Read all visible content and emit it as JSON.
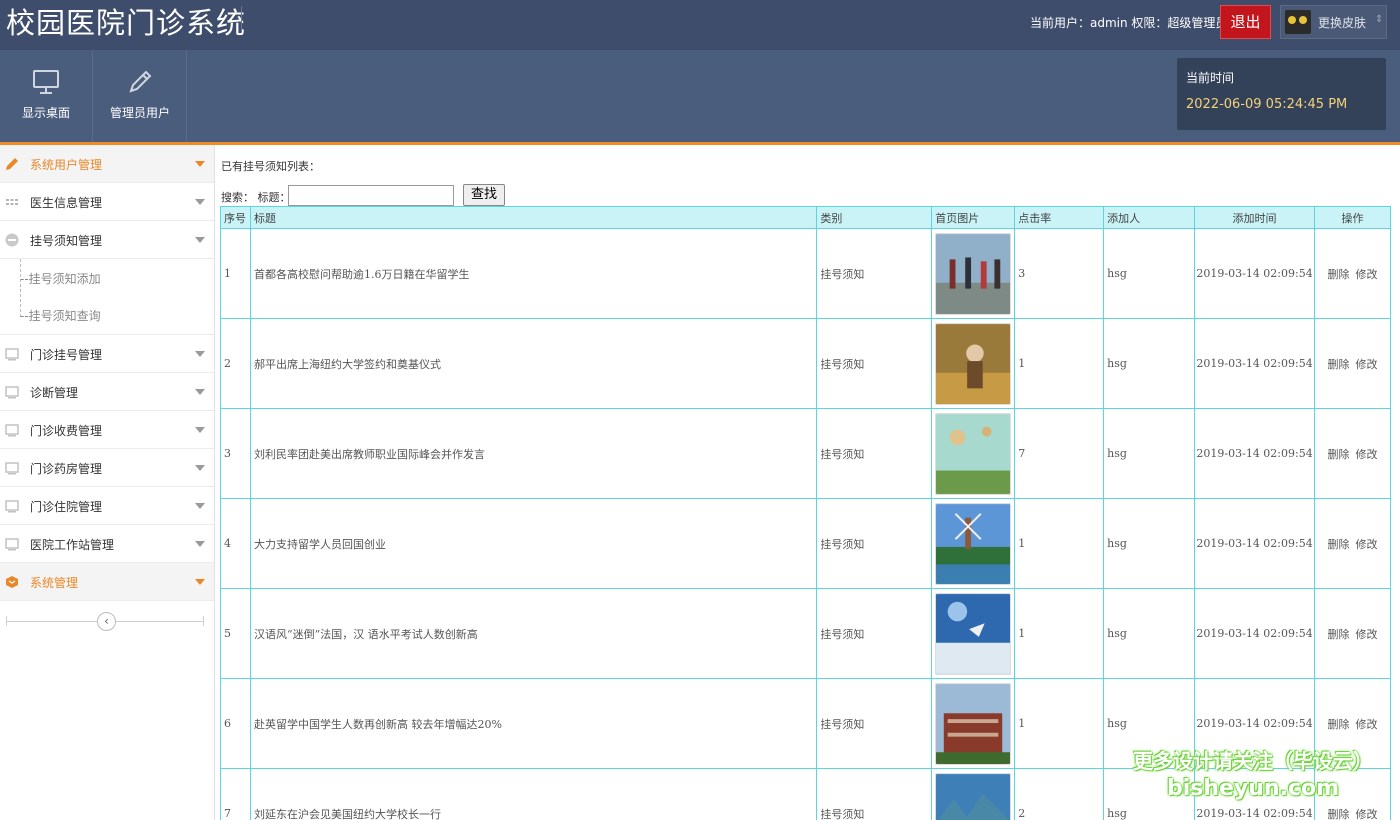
{
  "header": {
    "app_title": "校园医院门诊系统",
    "user_info": "当前用户：admin  权限：超级管理员",
    "logout_label": "退出",
    "skin_label": "更换皮肤"
  },
  "toolbar": {
    "items": [
      {
        "label": "显示桌面",
        "icon": "monitor-icon"
      },
      {
        "label": "管理员用户",
        "icon": "pencil-icon"
      }
    ],
    "time_label": "当前时间",
    "time_value": "2022-06-09 05:24:45 PM"
  },
  "sidebar": {
    "items": [
      {
        "label": "系统用户管理",
        "icon": "pencil-icon"
      },
      {
        "label": "医生信息管理",
        "icon": "grid-icon"
      },
      {
        "label": "挂号须知管理",
        "icon": "minus-circle-icon"
      },
      {
        "label": "门诊挂号管理",
        "icon": "screen-icon"
      },
      {
        "label": "诊断管理",
        "icon": "screen-icon"
      },
      {
        "label": "门诊收费管理",
        "icon": "screen-icon"
      },
      {
        "label": "门诊药房管理",
        "icon": "screen-icon"
      },
      {
        "label": "门诊住院管理",
        "icon": "screen-icon"
      },
      {
        "label": "医院工作站管理",
        "icon": "screen-icon"
      },
      {
        "label": "系统管理",
        "icon": "box-icon"
      }
    ],
    "sub_items": [
      "挂号须知添加",
      "挂号须知查询"
    ],
    "collapse_symbol": "‹"
  },
  "main": {
    "caption": "已有挂号须知列表：",
    "search_prefix": "搜索：  标题：",
    "search_value": "",
    "search_button": "查找",
    "columns": [
      "序号",
      "标题",
      "类别",
      "首页图片",
      "点击率",
      "添加人",
      "添加时间",
      "操作"
    ],
    "rows": [
      {
        "no": "1",
        "title": "首都各高校慰问帮助逾1.6万日籍在华留学生",
        "category": "挂号须知",
        "clicks": "3",
        "author": "hsg",
        "time": "2019-03-14 02:09:54"
      },
      {
        "no": "2",
        "title": "郝平出席上海纽约大学签约和奠基仪式",
        "category": "挂号须知",
        "clicks": "1",
        "author": "hsg",
        "time": "2019-03-14 02:09:54"
      },
      {
        "no": "3",
        "title": "刘利民率团赴美出席教师职业国际峰会并作发言",
        "category": "挂号须知",
        "clicks": "7",
        "author": "hsg",
        "time": "2019-03-14 02:09:54"
      },
      {
        "no": "4",
        "title": "大力支持留学人员回国创业",
        "category": "挂号须知",
        "clicks": "1",
        "author": "hsg",
        "time": "2019-03-14 02:09:54"
      },
      {
        "no": "5",
        "title": "汉语风“迷倒”法国，汉 语水平考试人数创新高",
        "category": "挂号须知",
        "clicks": "1",
        "author": "hsg",
        "time": "2019-03-14 02:09:54"
      },
      {
        "no": "6",
        "title": "赴英留学中国学生人数再创新高 较去年增幅达20%",
        "category": "挂号须知",
        "clicks": "1",
        "author": "hsg",
        "time": "2019-03-14 02:09:54"
      },
      {
        "no": "7",
        "title": "刘延东在沪会见美国纽约大学校长一行",
        "category": "挂号须知",
        "clicks": "2",
        "author": "hsg",
        "time": "2019-03-14 02:09:54"
      }
    ],
    "op_delete": "删除",
    "op_edit": "修改"
  },
  "watermark": {
    "line1": "更多设计请关注（毕设云）",
    "line2": "bisheyun.com"
  },
  "colors": {
    "header_bg": "#3e4d6b",
    "accent": "#f08a24",
    "table_border": "#5bd6de",
    "logout": "#c3161c"
  }
}
